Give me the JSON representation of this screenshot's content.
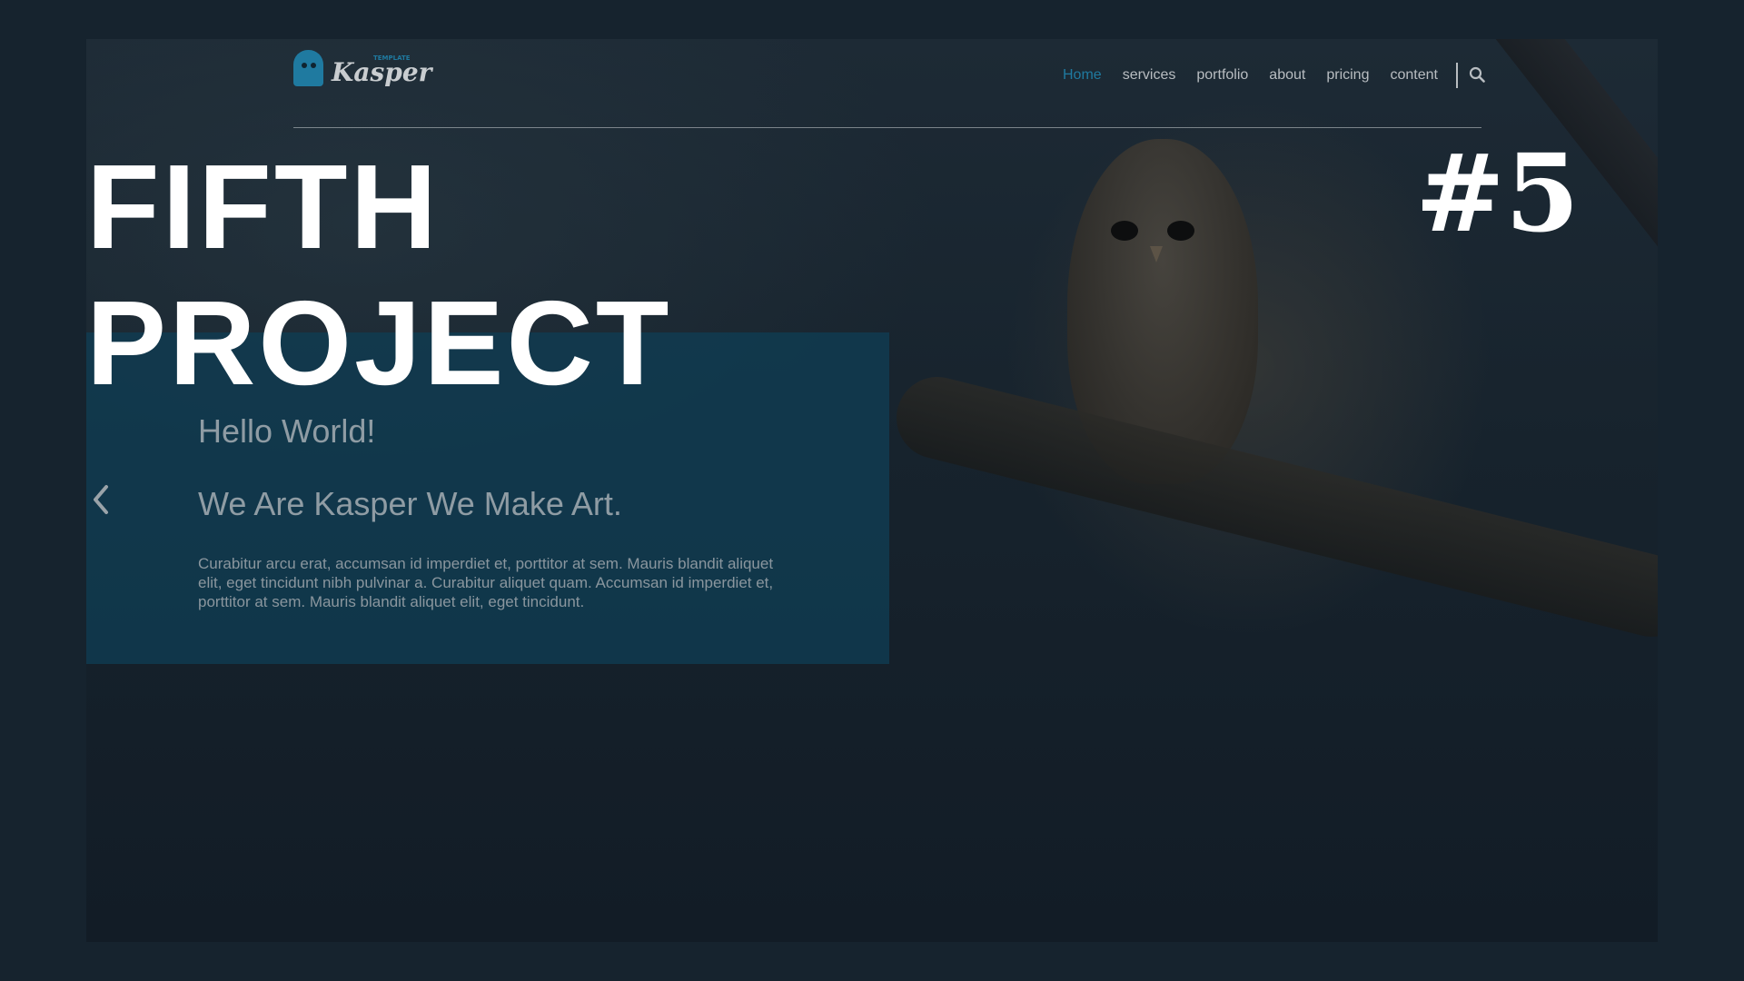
{
  "overlay": {
    "title_line1": "FIFTH",
    "title_line2": "PROJECT",
    "number": "#5"
  },
  "header": {
    "logo": {
      "tagline": "TEMPLATE",
      "name": "Kasper",
      "icon": "ghost-icon"
    },
    "nav": [
      {
        "label": "Home",
        "active": true
      },
      {
        "label": "services",
        "active": false
      },
      {
        "label": "portfolio",
        "active": false
      },
      {
        "label": "about",
        "active": false
      },
      {
        "label": "pricing",
        "active": false
      },
      {
        "label": "content",
        "active": false
      }
    ],
    "search_icon": "search-icon"
  },
  "hero": {
    "greeting": "Hello World!",
    "heading": "We Are Kasper We Make Art.",
    "body": "Curabitur arcu erat, accumsan id imperdiet et, porttitor at sem. Mauris blandit aliquet elit, eget tincidunt nibh pulvinar a. Curabitur aliquet quam. Accumsan id imperdiet et, porttitor at sem. Mauris blandit aliquet elit, eget tincidunt.",
    "prev_icon": "chevron-left-icon"
  },
  "colors": {
    "accent": "#1f7aa0",
    "page_background": "#16232e",
    "panel": "#103c52",
    "title_text": "#ffffff"
  }
}
